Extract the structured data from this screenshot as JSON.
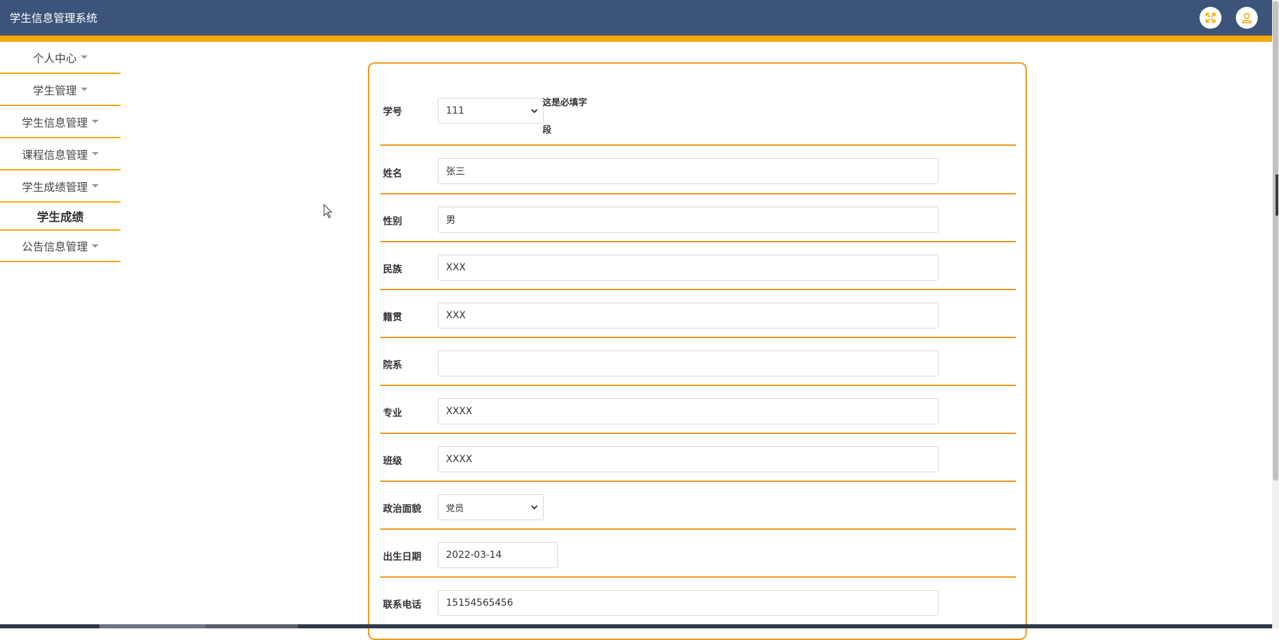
{
  "app": {
    "title": "学生信息管理系统"
  },
  "header_icons": {
    "fullscreen": "fullscreen-icon",
    "user": "user-icon"
  },
  "sidebar": {
    "items": [
      {
        "label": "个人中心",
        "has_caret": true
      },
      {
        "label": "学生管理",
        "has_caret": true
      },
      {
        "label": "学生信息管理",
        "has_caret": true
      },
      {
        "label": "课程信息管理",
        "has_caret": true
      },
      {
        "label": "学生成绩管理",
        "has_caret": true
      },
      {
        "label": "学生成绩",
        "has_caret": false,
        "active": true
      },
      {
        "label": "公告信息管理",
        "has_caret": true
      }
    ]
  },
  "form": {
    "student_id": {
      "label": "学号",
      "value": "111",
      "hint": "这是必填字段"
    },
    "name": {
      "label": "姓名",
      "value": "张三"
    },
    "gender": {
      "label": "性别",
      "value": "男"
    },
    "ethnicity": {
      "label": "民族",
      "value": "XXX"
    },
    "hometown": {
      "label": "籍贯",
      "value": "XXX"
    },
    "department": {
      "label": "院系",
      "value": ""
    },
    "major": {
      "label": "专业",
      "value": "XXXX"
    },
    "class": {
      "label": "班级",
      "value": "XXXX"
    },
    "political_status": {
      "label": "政治面貌",
      "value": "党员"
    },
    "birth_date": {
      "label": "出生日期",
      "value": "2022-03-14"
    },
    "phone": {
      "label": "联系电话",
      "value": "15154565456"
    }
  },
  "colors": {
    "header_bg": "#3c5479",
    "accent": "#f5a905",
    "form_border": "#f0951f"
  }
}
